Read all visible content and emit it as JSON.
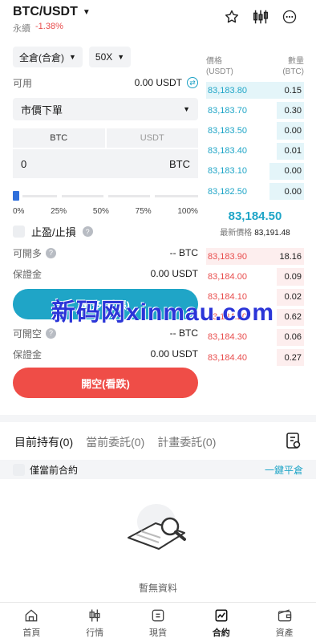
{
  "header": {
    "pair": "BTC/USDT",
    "type": "永續",
    "change": "-1.38%"
  },
  "controls": {
    "margin_mode": "全倉(合倉)",
    "leverage": "50X",
    "available_label": "可用",
    "available_value": "0.00 USDT",
    "order_type": "市價下單"
  },
  "unit_tabs": [
    "BTC",
    "USDT"
  ],
  "amount": {
    "value": "0",
    "unit": "BTC"
  },
  "slider": {
    "level_percent": 0,
    "labels": [
      "0%",
      "25%",
      "50%",
      "75%",
      "100%"
    ]
  },
  "tpsl_label": "止盈/止損",
  "long": {
    "openable_label": "可開多",
    "openable_value": "-- BTC",
    "margin_label": "保證金",
    "margin_value": "0.00 USDT",
    "button": "開多(看漲)"
  },
  "short": {
    "openable_label": "可開空",
    "openable_value": "-- BTC",
    "margin_label": "保證金",
    "margin_value": "0.00 USDT",
    "button": "開空(看跌)"
  },
  "book": {
    "price_header": "價格",
    "price_unit": "(USDT)",
    "qty_header": "數量",
    "qty_unit": "(BTC)",
    "asks": [
      {
        "price": "83,183.80",
        "qty": "0.15",
        "depth": 1.0
      },
      {
        "price": "83,183.70",
        "qty": "0.30",
        "depth": 0.28
      },
      {
        "price": "83,183.50",
        "qty": "0.00",
        "depth": 0.28
      },
      {
        "price": "83,183.40",
        "qty": "0.01",
        "depth": 0.28
      },
      {
        "price": "83,183.10",
        "qty": "0.00",
        "depth": 0.35
      },
      {
        "price": "83,182.50",
        "qty": "0.00",
        "depth": 0.35
      }
    ],
    "last_price": "83,184.50",
    "mark_label": "最新價格",
    "mark_price": "83,191.48",
    "bids": [
      {
        "price": "83,183.90",
        "qty": "18.16",
        "depth": 1.0
      },
      {
        "price": "83,184.00",
        "qty": "0.09",
        "depth": 0.28
      },
      {
        "price": "83,184.10",
        "qty": "0.02",
        "depth": 0.28
      },
      {
        "price": "83,184.20",
        "qty": "0.62",
        "depth": 0.28
      },
      {
        "price": "83,184.30",
        "qty": "0.06",
        "depth": 0.28
      },
      {
        "price": "83,184.40",
        "qty": "0.27",
        "depth": 0.28
      }
    ]
  },
  "positions": {
    "tabs": [
      "目前持有(0)",
      "當前委託(0)",
      "計畫委託(0)"
    ],
    "filter_label": "僅當前合約",
    "close_all": "一鍵平倉",
    "empty": "暫無資料"
  },
  "nav": [
    "首頁",
    "行情",
    "現貨",
    "合約",
    "資產"
  ],
  "watermark": "新码网xinmau.com",
  "colors": {
    "long": "#1fa5c7",
    "short": "#ef4d47"
  }
}
